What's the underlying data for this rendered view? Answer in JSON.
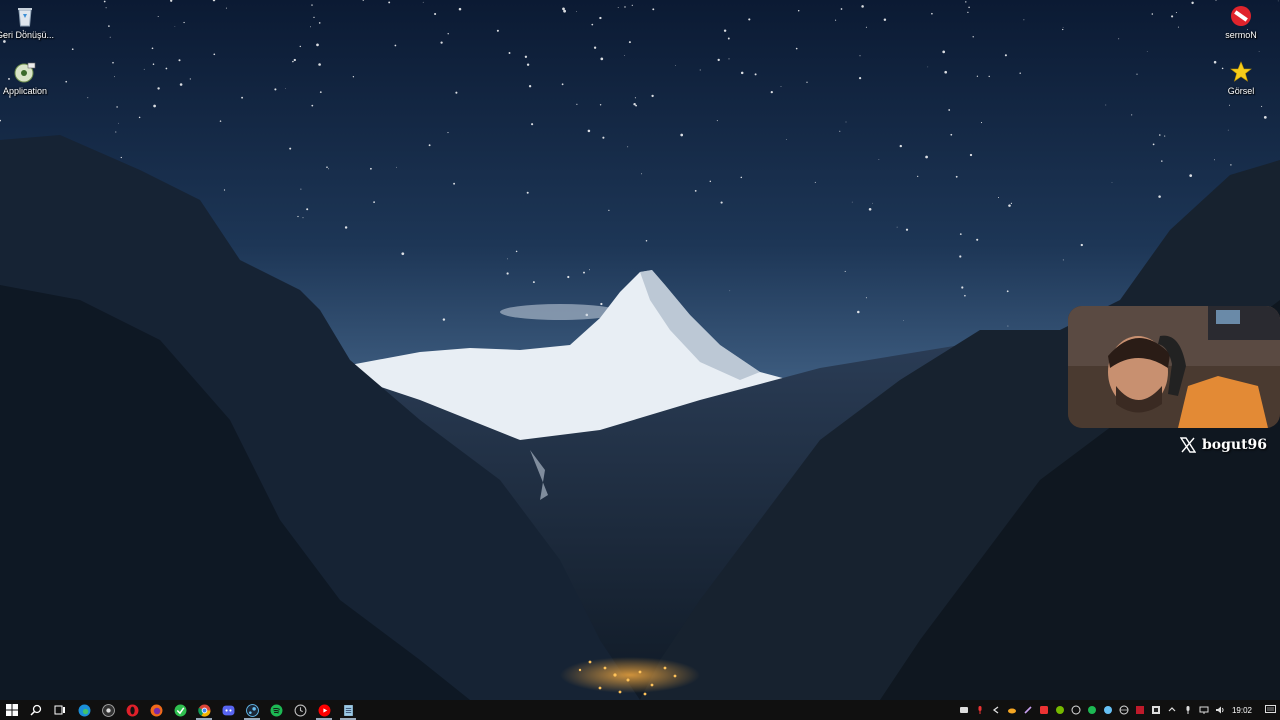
{
  "desktop": {
    "icons_left": [
      {
        "label": "Geri Dönüşü...",
        "icon": "recycle-bin-icon"
      },
      {
        "label": "Application",
        "icon": "application-disc-icon"
      }
    ],
    "icons_right": [
      {
        "label": "sermoN",
        "icon": "no-entry-icon"
      },
      {
        "label": "Görsel",
        "icon": "star-icon"
      }
    ]
  },
  "overlay": {
    "social_handle": "bogut96",
    "social_icon": "x-logo-icon"
  },
  "taskbar": {
    "pinned": [
      "start-icon",
      "search-icon",
      "task-view-icon",
      "edge-icon",
      "obs-icon",
      "opera-icon",
      "firefox-icon",
      "vpn-icon",
      "chrome-icon",
      "discord-icon",
      "steam-icon",
      "spotify-icon",
      "clock-app-icon",
      "youtube-music-icon",
      "notepad-icon"
    ],
    "tray_icons": [
      "tray-app-icon",
      "tray-mic-app-icon",
      "tray-arrow-icon",
      "tray-cloud-icon",
      "tray-pen-icon",
      "tray-red-icon",
      "tray-nvidia-icon",
      "tray-chat-icon",
      "tray-spotify-icon",
      "tray-steam-icon",
      "tray-globe-icon",
      "tray-app2-icon",
      "tray-app3-icon",
      "tray-chevron-icon",
      "microphone-icon",
      "network-icon",
      "volume-icon"
    ],
    "clock": "19:02"
  },
  "colors": {
    "sky_top": "#0b1a33",
    "sky_mid": "#27466a",
    "snow": "#e8eef4",
    "taskbar": "#101010",
    "webcam_shirt": "#e38a35"
  }
}
